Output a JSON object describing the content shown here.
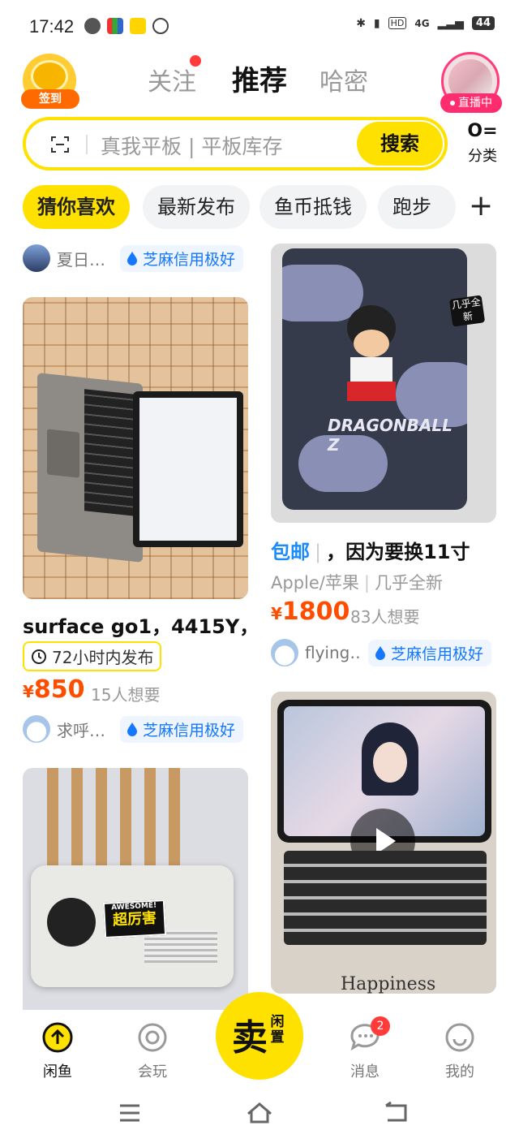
{
  "status_bar": {
    "time": "17:42",
    "battery": "44",
    "network": "4G"
  },
  "header": {
    "checkin_label": "签到",
    "tabs": [
      {
        "label": "关注"
      },
      {
        "label": "推荐"
      },
      {
        "label": "哈密"
      }
    ],
    "live_label": "直播中"
  },
  "search": {
    "placeholder": "真我平板 | 平板库存",
    "button": "搜索",
    "category_label": "分类"
  },
  "chips": [
    {
      "label": "猜你喜欢"
    },
    {
      "label": "最新发布"
    },
    {
      "label": "鱼币抵钱"
    },
    {
      "label": "跑步"
    }
  ],
  "feed": {
    "left": [
      {
        "seller": "夏日…",
        "credit": "芝麻信用极好"
      },
      {
        "title": "surface go1，4415Y，",
        "time_badge": "72小时内发布",
        "price_symbol": "¥",
        "price": "850",
        "want": "15人想要",
        "seller": "求呼…",
        "credit": "芝麻信用极好"
      },
      {
        "sticker_top": "AWESOME!",
        "sticker_main": "超厉害"
      }
    ],
    "right": [
      {
        "sticker": "几乎全新",
        "title_tag": "包邮",
        "title": "，因为要换11寸",
        "sub_brand": "Apple/苹果",
        "sub_condition": "几乎全新",
        "price_symbol": "¥",
        "price": "1800",
        "want": "83人想要",
        "seller": "flying…",
        "credit": "芝麻信用极好"
      },
      {
        "caption": "Happiness"
      }
    ]
  },
  "bottom_nav": {
    "items": [
      {
        "label": "闲鱼"
      },
      {
        "label": "会玩"
      },
      {
        "label": "消息",
        "badge": "2"
      },
      {
        "label": "我的"
      }
    ],
    "sell_main": "卖",
    "sell_sub": "闲置"
  },
  "colors": {
    "brand_yellow": "#ffe100",
    "price_orange": "#ff4d00",
    "credit_blue": "#1677ff"
  }
}
